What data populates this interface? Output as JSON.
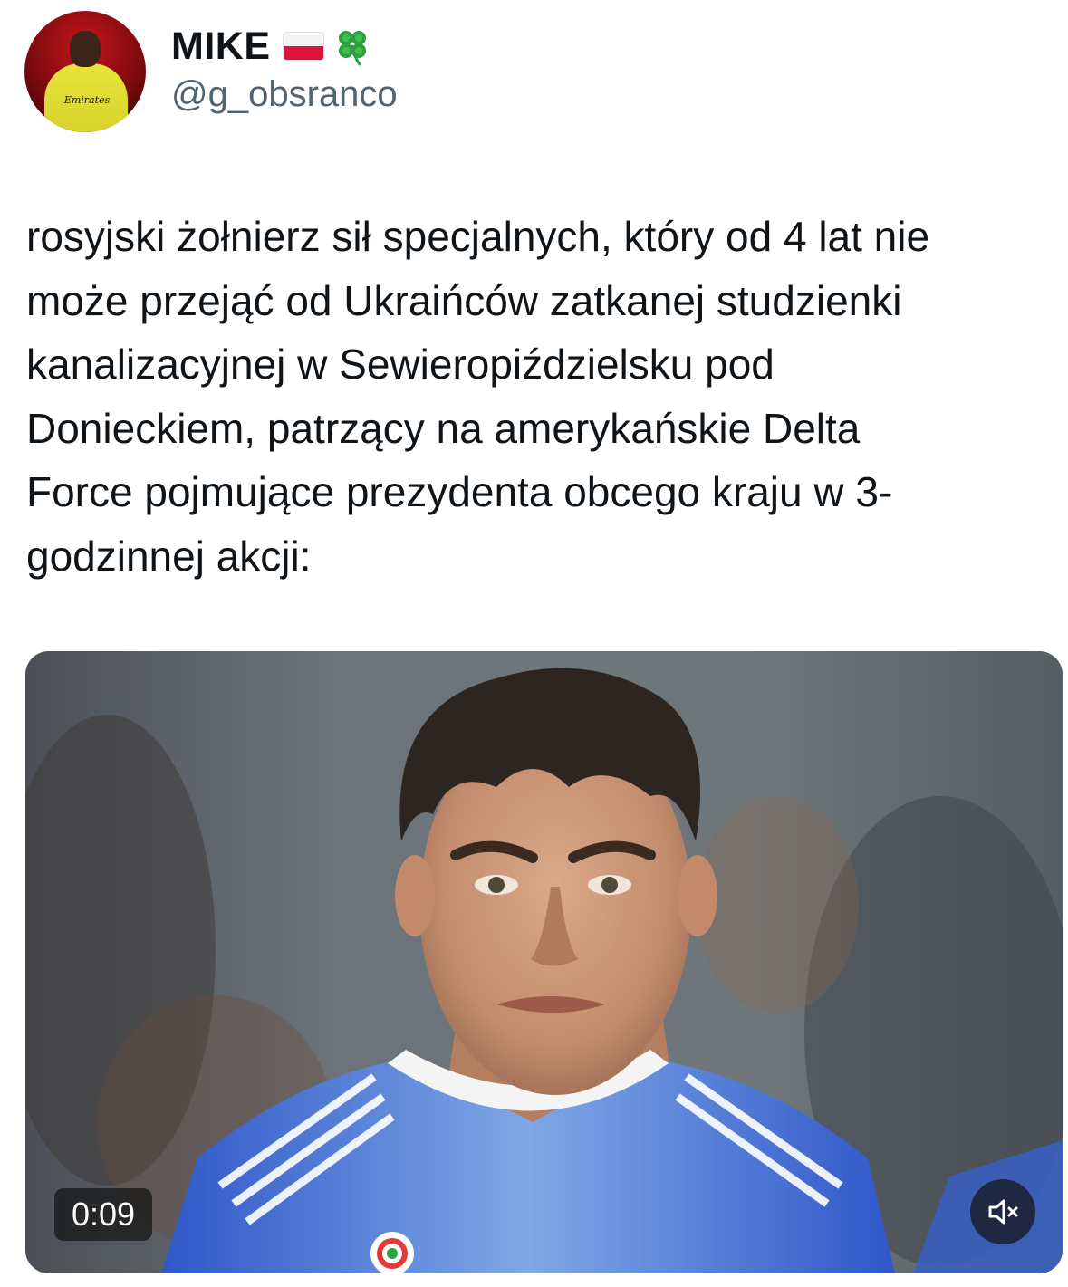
{
  "author": {
    "display_name": "MIKE",
    "handle": "@g_obsranco",
    "avatar_jersey_text": "Emirates",
    "badges": [
      "poland-flag-icon",
      "four-leaf-clover-icon"
    ]
  },
  "tweet": {
    "text": "rosyjski żołnierz sił specjalnych, który od 4 lat nie\nmoże przejąć od Ukraińców zatkanej studzienki\nkanalizacyjnej w Sewieropiździelsku pod\nDonieckiem, patrzący na amerykańskie Delta\nForce pojmujące prezydenta obcego kraju w 3-\ngodzinnej akcji:"
  },
  "media": {
    "type": "video",
    "duration": "0:09",
    "mute_icon": "speaker-muted-icon"
  },
  "colors": {
    "text_primary": "#0f1419",
    "text_secondary": "#536471",
    "flag_red": "#dc143c",
    "clover_green": "#2e9e3f",
    "overlay": "#141414"
  }
}
